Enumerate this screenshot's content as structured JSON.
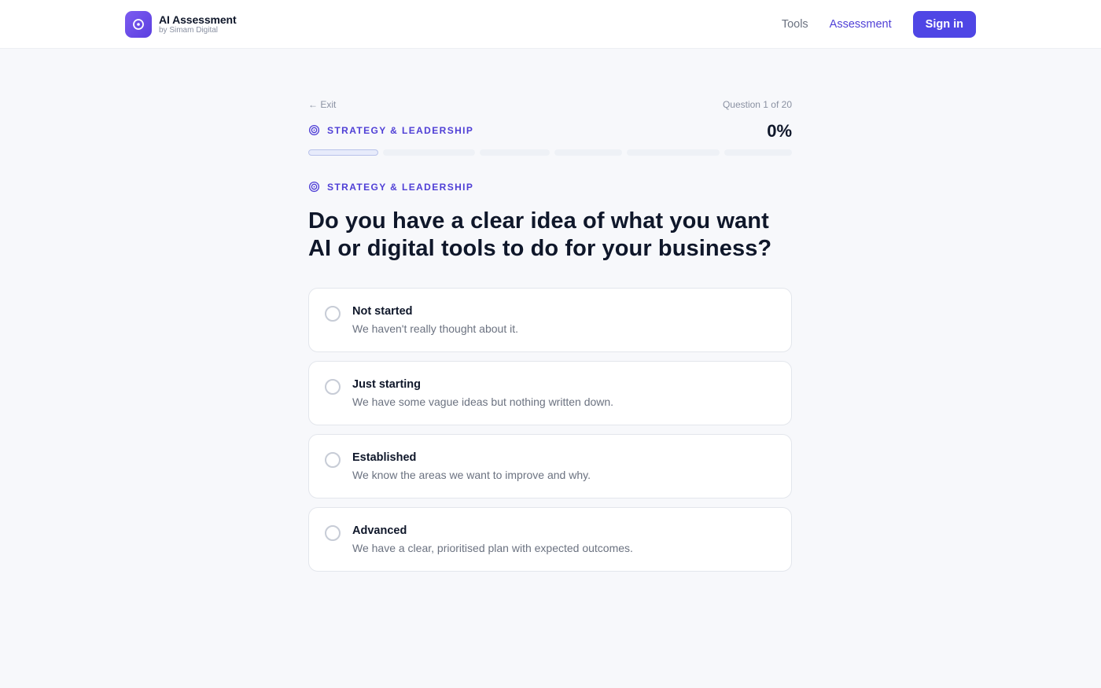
{
  "header": {
    "brand_title": "AI Assessment",
    "brand_subtitle": "by Simam Digital",
    "nav": [
      {
        "label": "Tools",
        "active": false
      },
      {
        "label": "Assessment",
        "active": true
      }
    ],
    "signin_label": "Sign in"
  },
  "quiz": {
    "exit_label": "← Exit",
    "question_counter": "Question 1 of 20",
    "category_label": "STRATEGY & LEADERSHIP",
    "progress_percent_label": "0%",
    "progress_fraction": 0,
    "question": "Do you have a clear idea of what you want AI or digital tools to do for your business?",
    "options": [
      {
        "title": "Not started",
        "description": "We haven't really thought about it."
      },
      {
        "title": "Just starting",
        "description": "We have some vague ideas but nothing written down."
      },
      {
        "title": "Established",
        "description": "We know the areas we want to improve and why."
      },
      {
        "title": "Advanced",
        "description": "We have a clear, prioritised plan with expected outcomes."
      }
    ]
  },
  "colors": {
    "accent": "#4f46e5",
    "category": "#4f3fd6",
    "page_bg": "#f7f8fb"
  },
  "icons": {
    "brand": "target-icon",
    "category": "target-icon"
  }
}
